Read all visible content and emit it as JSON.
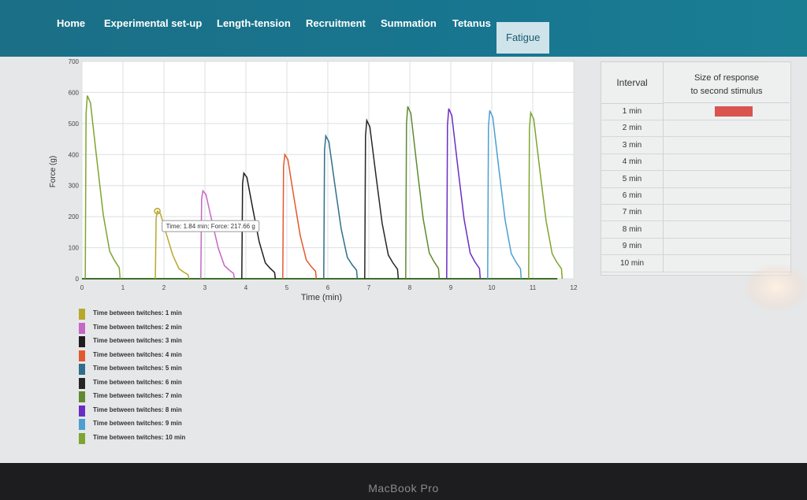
{
  "nav": {
    "tabs": [
      {
        "label": "Home"
      },
      {
        "label": "Experimental set-up"
      },
      {
        "label": "Length-tension"
      },
      {
        "label": "Recruitment"
      },
      {
        "label": "Summation"
      },
      {
        "label": "Tetanus"
      },
      {
        "label": "Fatigue"
      }
    ],
    "active_tab": "Fatigue"
  },
  "chart_data": {
    "type": "line",
    "title": "",
    "xlabel": "Time (min)",
    "ylabel": "Force (g)",
    "xlim": [
      0,
      12
    ],
    "ylim": [
      0,
      700
    ],
    "xticks": [
      0,
      1,
      2,
      3,
      4,
      5,
      6,
      7,
      8,
      9,
      10,
      11,
      12
    ],
    "yticks": [
      0,
      100,
      200,
      300,
      400,
      500,
      600,
      700
    ],
    "grid": true,
    "tooltip": {
      "text": "Time: 1.84 min; Force: 217.66 g",
      "x": 1.84,
      "y": 217.66
    },
    "series": [
      {
        "name": "Time between twitches: 1 min",
        "color": "#b8a82a",
        "peak_time": 1.84,
        "peak_force": 217.66
      },
      {
        "name": "Time between twitches: 2 min",
        "color": "#c467c4",
        "peak_time": 2.95,
        "peak_force": 283
      },
      {
        "name": "Time between twitches: 3 min",
        "color": "#1e1e1e",
        "peak_time": 3.95,
        "peak_force": 340
      },
      {
        "name": "Time between twitches: 4 min",
        "color": "#e4582f",
        "peak_time": 4.95,
        "peak_force": 400
      },
      {
        "name": "Time between twitches: 5 min",
        "color": "#2f6f8c",
        "peak_time": 5.95,
        "peak_force": 460
      },
      {
        "name": "Time between twitches: 6 min",
        "color": "#262626",
        "peak_time": 6.95,
        "peak_force": 510
      },
      {
        "name": "Time between twitches: 7 min",
        "color": "#5f8a2f",
        "peak_time": 7.95,
        "peak_force": 555
      },
      {
        "name": "Time between twitches: 8 min",
        "color": "#6b2cc4",
        "peak_time": 8.95,
        "peak_force": 548
      },
      {
        "name": "Time between twitches: 9 min",
        "color": "#4c9fd1",
        "peak_time": 9.95,
        "peak_force": 542
      },
      {
        "name": "Time between twitches: 10 min",
        "color": "#7ea52f",
        "peak_time": 10.95,
        "peak_force": 535
      }
    ],
    "first_twitch": {
      "time": 0.08,
      "force": 590,
      "color": "#7ea52f"
    }
  },
  "table": {
    "header_interval": "Interval",
    "header_size_line1": "Size of response",
    "header_size_line2": "to second stimulus",
    "rows": [
      {
        "interval": "1 min",
        "filled": true
      },
      {
        "interval": "2 min",
        "filled": false
      },
      {
        "interval": "3 min",
        "filled": false
      },
      {
        "interval": "4 min",
        "filled": false
      },
      {
        "interval": "5 min",
        "filled": false
      },
      {
        "interval": "6 min",
        "filled": false
      },
      {
        "interval": "7 min",
        "filled": false
      },
      {
        "interval": "8 min",
        "filled": false
      },
      {
        "interval": "9 min",
        "filled": false
      },
      {
        "interval": "10 min",
        "filled": false
      }
    ],
    "fill_color": "#d9534f"
  },
  "device": {
    "label": "MacBook Pro"
  }
}
